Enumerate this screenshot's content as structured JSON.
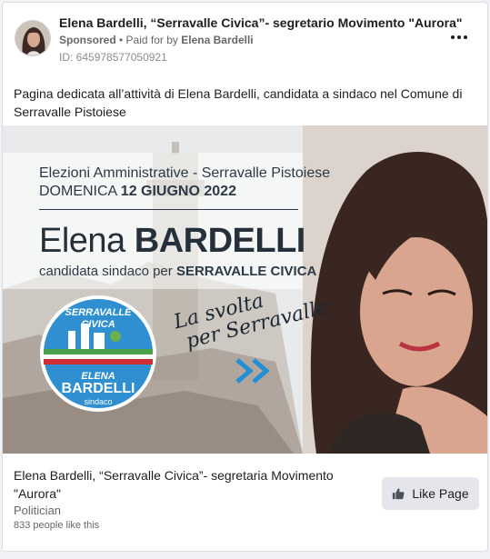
{
  "header": {
    "advertiser_name": "Elena Bardelli, “Serravalle Civica”- segretario Movimento \"Aurora\"",
    "sponsored_label": "Sponsored",
    "separator": " • ",
    "paid_for_prefix": "Paid for by ",
    "paid_for_name": "Elena Bardelli",
    "ad_id": "ID: 645978577050921",
    "more_icon": "more-horizontal-icon"
  },
  "body_text": "Pagina dedicata all’attività di Elena Bardelli, candidata a sindaco nel Comune di Serravalle Pistoiese",
  "creative": {
    "line1": "Elezioni Amministrative - Serravalle Pistoiese",
    "line2_prefix": "DOMENICA ",
    "line2_date": "12 GIUGNO 2022",
    "name_first": "Elena ",
    "name_last": "BARDELLI",
    "role_prefix": "candidata sindaco per ",
    "role_party": "SERRAVALLE CIVICA",
    "slogan_line1": "La svolta",
    "slogan_line2": "per Serravalle",
    "logo_line1": "SERRAVALLE",
    "logo_line2": "CIVICA",
    "logo_line3": "ELENA",
    "logo_line4": "BARDELLI",
    "logo_line5": "sindaco",
    "arrow_icon": "double-chevron-right-icon"
  },
  "footer": {
    "page_title": "Elena Bardelli, “Serravalle Civica”- segretaria Movimento \"Aurora\"",
    "category": "Politician",
    "likes": "833 people like this",
    "like_button_label": "Like Page",
    "like_icon": "thumbs-up-icon"
  },
  "colors": {
    "accent_blue": "#1f8fd6",
    "logo_green": "#5a9b3c",
    "button_bg": "#e4e6eb",
    "text_secondary": "#65676b"
  }
}
